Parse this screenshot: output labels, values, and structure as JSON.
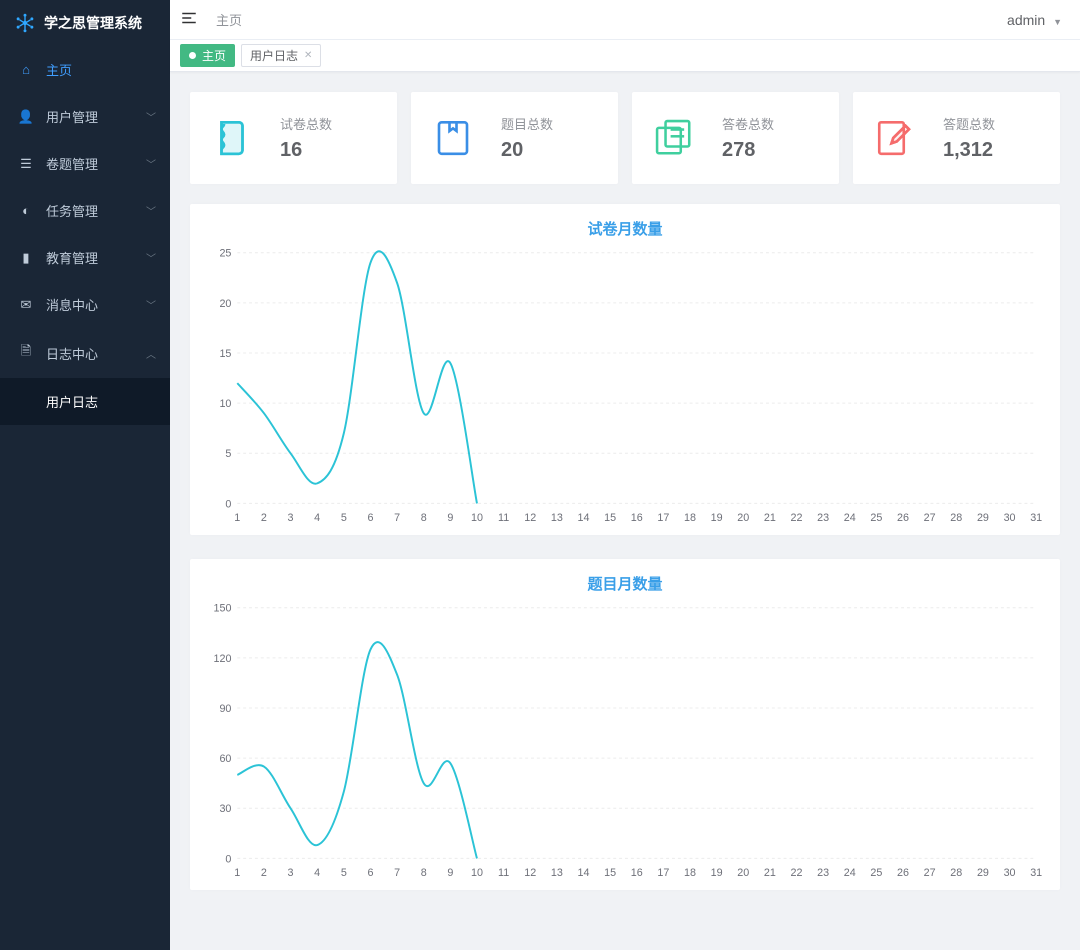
{
  "brand": "学之思管理系统",
  "header": {
    "breadcrumb": "主页",
    "user": "admin"
  },
  "tabs": {
    "active": "主页",
    "other": "用户日志"
  },
  "sidebar": {
    "items": [
      {
        "icon": "home",
        "label": "主页",
        "expandable": false,
        "active": true
      },
      {
        "icon": "user",
        "label": "用户管理",
        "expandable": true
      },
      {
        "icon": "list",
        "label": "卷题管理",
        "expandable": true
      },
      {
        "icon": "task",
        "label": "任务管理",
        "expandable": true
      },
      {
        "icon": "edu",
        "label": "教育管理",
        "expandable": true
      },
      {
        "icon": "mail",
        "label": "消息中心",
        "expandable": true
      },
      {
        "icon": "log",
        "label": "日志中心",
        "expandable": true,
        "open": true
      }
    ],
    "sub_log": "用户日志"
  },
  "stats": [
    {
      "label": "试卷总数",
      "value": "16",
      "color": "#2bc3d6",
      "icon": "paper"
    },
    {
      "label": "题目总数",
      "value": "20",
      "color": "#3a8ee6",
      "icon": "question"
    },
    {
      "label": "答卷总数",
      "value": "278",
      "color": "#3fcf9e",
      "icon": "answer"
    },
    {
      "label": "答题总数",
      "value": "1,312",
      "color": "#f56c6c",
      "icon": "edit"
    }
  ],
  "chart_data": [
    {
      "type": "line",
      "title": "试卷月数量",
      "xlabel": "",
      "ylabel": "",
      "ylim": [
        0,
        25
      ],
      "yticks": [
        0,
        5,
        10,
        15,
        20,
        25
      ],
      "x": [
        1,
        2,
        3,
        4,
        5,
        6,
        7,
        8,
        9,
        10,
        11,
        12,
        13,
        14,
        15,
        16,
        17,
        18,
        19,
        20,
        21,
        22,
        23,
        24,
        25,
        26,
        27,
        28,
        29,
        30,
        31
      ],
      "series": [
        {
          "name": "试卷",
          "color": "#2bc3d6",
          "values": [
            12,
            9,
            5,
            2,
            7,
            24,
            22,
            9,
            14,
            0,
            null,
            null,
            null,
            null,
            null,
            null,
            null,
            null,
            null,
            null,
            null,
            null,
            null,
            null,
            null,
            null,
            null,
            null,
            null,
            null,
            null
          ]
        }
      ]
    },
    {
      "type": "line",
      "title": "题目月数量",
      "xlabel": "",
      "ylabel": "",
      "ylim": [
        0,
        150
      ],
      "yticks": [
        0,
        30,
        60,
        90,
        120,
        150
      ],
      "x": [
        1,
        2,
        3,
        4,
        5,
        6,
        7,
        8,
        9,
        10,
        11,
        12,
        13,
        14,
        15,
        16,
        17,
        18,
        19,
        20,
        21,
        22,
        23,
        24,
        25,
        26,
        27,
        28,
        29,
        30,
        31
      ],
      "series": [
        {
          "name": "题目",
          "color": "#2bc3d6",
          "values": [
            50,
            55,
            30,
            8,
            40,
            125,
            110,
            45,
            57,
            0,
            null,
            null,
            null,
            null,
            null,
            null,
            null,
            null,
            null,
            null,
            null,
            null,
            null,
            null,
            null,
            null,
            null,
            null,
            null,
            null,
            null
          ]
        }
      ]
    }
  ]
}
